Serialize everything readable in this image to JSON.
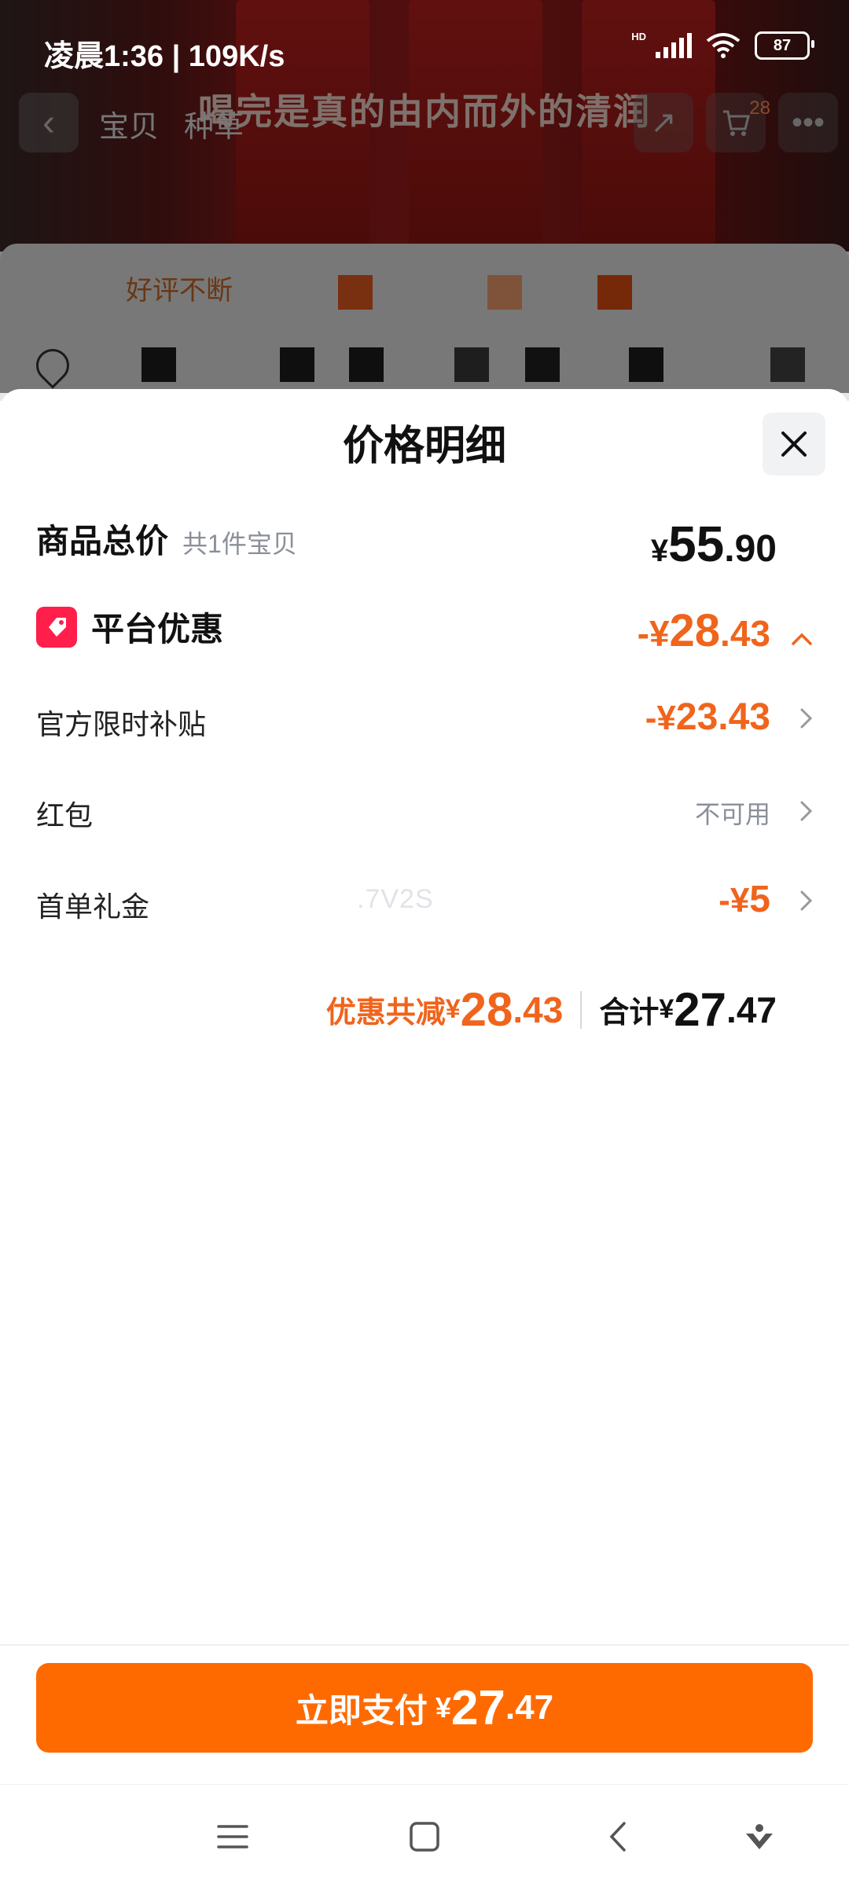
{
  "status_bar": {
    "time_speed": "凌晨1:36 | 109K/s",
    "network": "HD",
    "battery": "87"
  },
  "background": {
    "caption": "喝完是真的由内而外的清润",
    "tabs": [
      "宝贝",
      "种草"
    ],
    "cart_count": "28",
    "good_review": "好评不断"
  },
  "sheet": {
    "title": "价格明细",
    "total_row": {
      "label": "商品总价",
      "sub": "共1件宝贝",
      "currency": "¥",
      "int": "55",
      "dec": ".90"
    },
    "platform_row": {
      "label": "平台优惠",
      "prefix": "-¥",
      "int": "28",
      "dec": ".43"
    },
    "items": [
      {
        "label": "官方限时补贴",
        "prefix": "-¥",
        "int": "23",
        "dec": ".43"
      },
      {
        "label": "红包",
        "value": "不可用"
      },
      {
        "label": "首单礼金",
        "prefix": "-¥",
        "int": "5",
        "dec": "",
        "ghost": ".7V2S"
      }
    ],
    "summary": {
      "discount_label": "优惠共减",
      "discount_currency": "¥",
      "discount_int": "28",
      "discount_dec": ".43",
      "total_label": "合计",
      "total_currency": "¥",
      "total_int": "27",
      "total_dec": ".47"
    }
  },
  "pay_button": {
    "label": "立即支付",
    "currency": "¥",
    "int": "27",
    "dec": ".47"
  },
  "colors": {
    "accent_orange": "#ff6a00",
    "discount_orange": "#f0641c",
    "tag_red": "#ff1f4a"
  }
}
